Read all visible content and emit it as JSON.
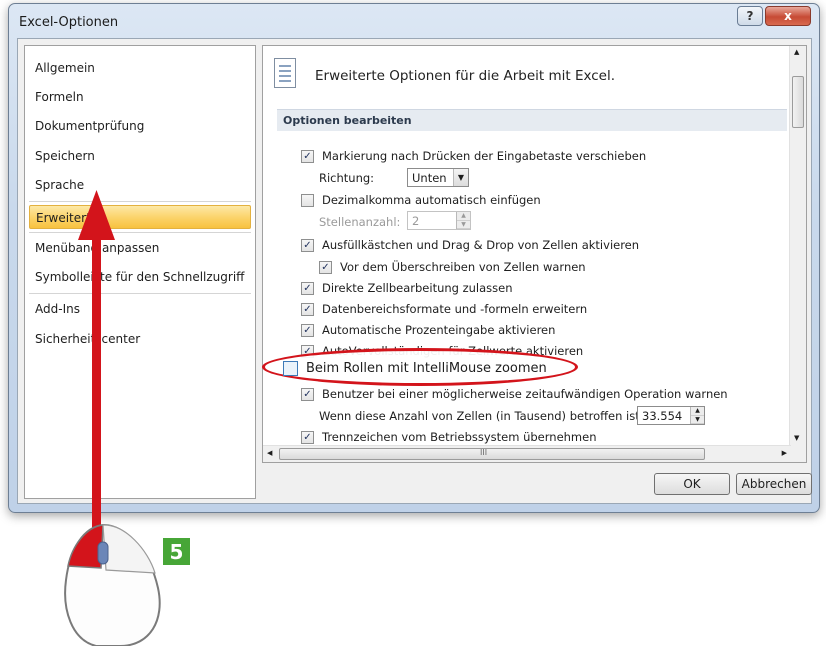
{
  "window": {
    "title": "Excel-Optionen",
    "help_label": "?",
    "close_label": "x"
  },
  "nav": {
    "items": [
      {
        "label": "Allgemein"
      },
      {
        "label": "Formeln"
      },
      {
        "label": "Dokumentprüfung"
      },
      {
        "label": "Speichern"
      },
      {
        "label": "Sprache"
      },
      {
        "label": "Erweitert",
        "selected": true
      },
      {
        "label": "Menüband anpassen"
      },
      {
        "label": "Symbolleiste für den Schnellzugriff"
      },
      {
        "label": "Add-Ins"
      },
      {
        "label": "Sicherheitscenter"
      }
    ]
  },
  "content": {
    "header": "Erweiterte Optionen für die Arbeit mit Excel.",
    "section": "Optionen bearbeiten",
    "opt1": "Markierung nach Drücken der Eingabetaste verschieben",
    "richtung_label": "Richtung:",
    "richtung_value": "Unten",
    "opt2": "Dezimalkomma automatisch einfügen",
    "stellen_label": "Stellenanzahl:",
    "stellen_value": "2",
    "opt3": "Ausfüllkästchen und Drag & Drop von Zellen aktivieren",
    "opt4": "Vor dem Überschreiben von Zellen warnen",
    "opt5": "Direkte Zellbearbeitung zulassen",
    "opt6": "Datenbereichsformate und -formeln erweitern",
    "opt7": "Automatische Prozenteingabe aktivieren",
    "opt8": "AutoVervollständigen für Zellwerte aktivieren",
    "opt9": "Beim Rollen mit IntelliMouse zoomen",
    "opt10": "Benutzer bei einer möglicherweise zeitaufwändigen Operation warnen",
    "zellen_label": "Wenn diese Anzahl von Zellen (in Tausend) betroffen ist:",
    "zellen_value": "33.554",
    "opt11": "Trennzeichen vom Betriebssystem übernehmen",
    "hscroll_grip": "III"
  },
  "buttons": {
    "ok": "OK",
    "cancel": "Abbrechen"
  },
  "annotation": {
    "step_number": "5",
    "accent_red": "#d3141b",
    "badge_green": "#47a637"
  }
}
